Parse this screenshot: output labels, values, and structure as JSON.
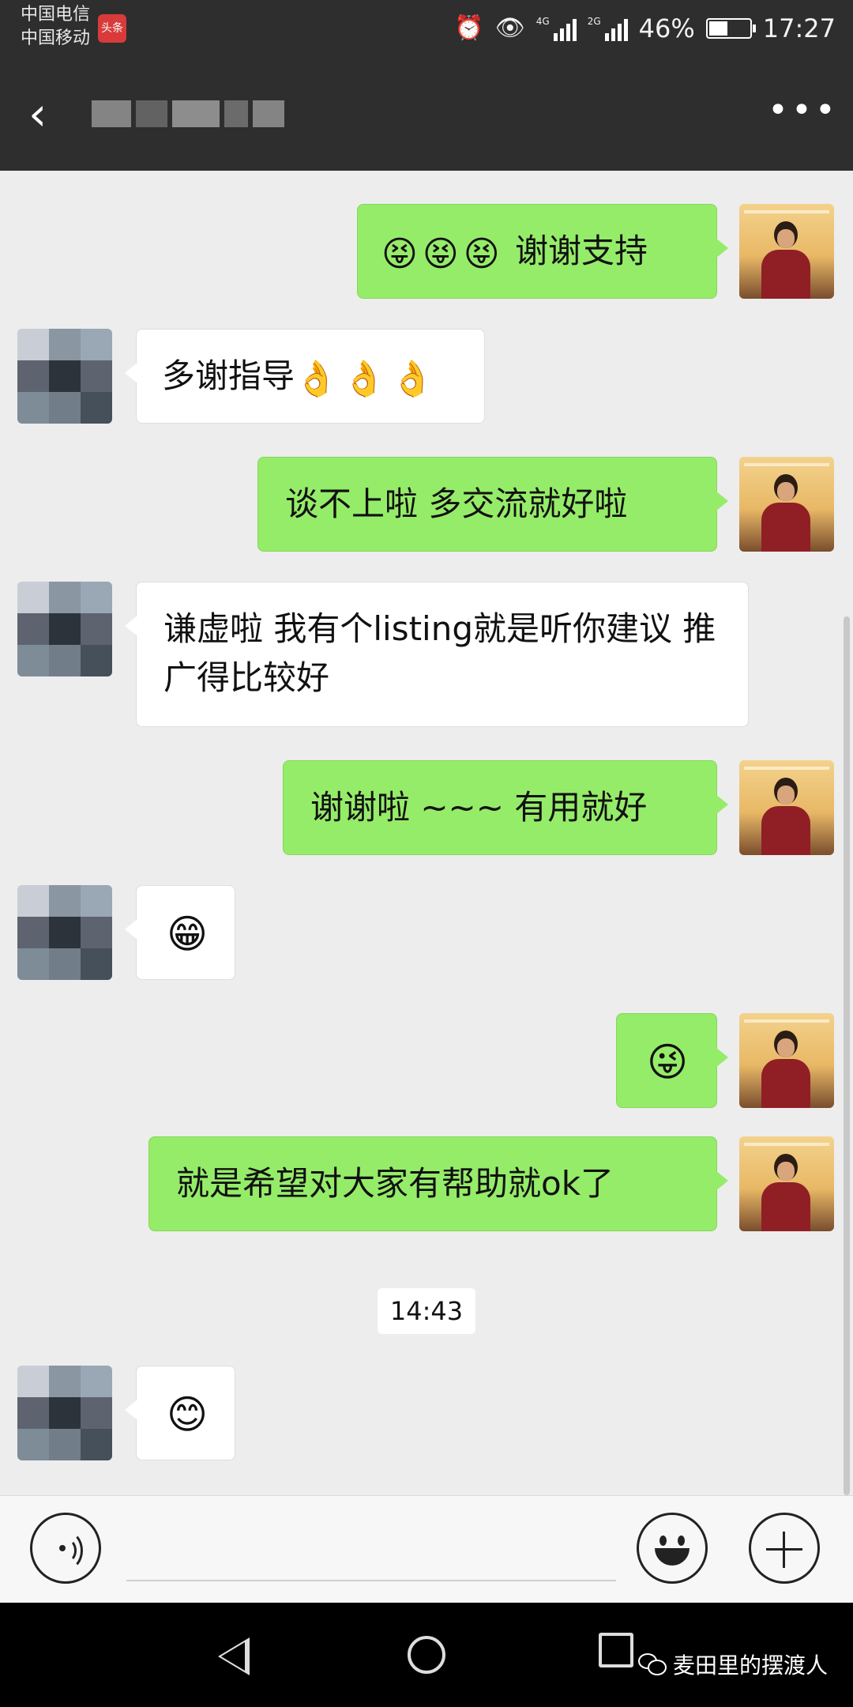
{
  "status_bar": {
    "carrier_1": "中国电信",
    "carrier_2": "中国移动",
    "app_badge": "头条",
    "net_1": "4G",
    "net_2": "2G",
    "battery_percent": "46%",
    "battery_level": 0.46,
    "time": "17:27"
  },
  "header": {
    "back_icon": "‹",
    "more_icon": "•••"
  },
  "messages": [
    {
      "sender": "self",
      "emojis": [
        "😝",
        "😝",
        "😝"
      ],
      "text": "谢谢支持"
    },
    {
      "sender": "other",
      "text": "多谢指导",
      "emojis": [
        "👌",
        "👌",
        "👌"
      ]
    },
    {
      "sender": "self",
      "text": "谈不上啦 多交流就好啦"
    },
    {
      "sender": "other",
      "text": "谦虚啦 我有个listing就是听你建议 推广得比较好"
    },
    {
      "sender": "self",
      "text": "谢谢啦 ~~~ 有用就好"
    },
    {
      "sender": "other",
      "emoji": "😁"
    },
    {
      "sender": "self",
      "emoji": "😜"
    },
    {
      "sender": "self",
      "text": "就是希望对大家有帮助就ok了"
    },
    {
      "sender": "other",
      "emoji": "😊"
    }
  ],
  "time_divider": "14:43",
  "input_bar": {
    "voice_icon": "voice-icon",
    "emoji_icon": "emoji-icon",
    "plus_icon": "plus-icon"
  },
  "system_nav": {
    "watermark": "麦田里的摆渡人"
  },
  "colors": {
    "self_bubble": "#95ec69",
    "other_bubble": "#ffffff",
    "header_bg": "#2e2e2e",
    "chat_bg": "#ededed"
  }
}
